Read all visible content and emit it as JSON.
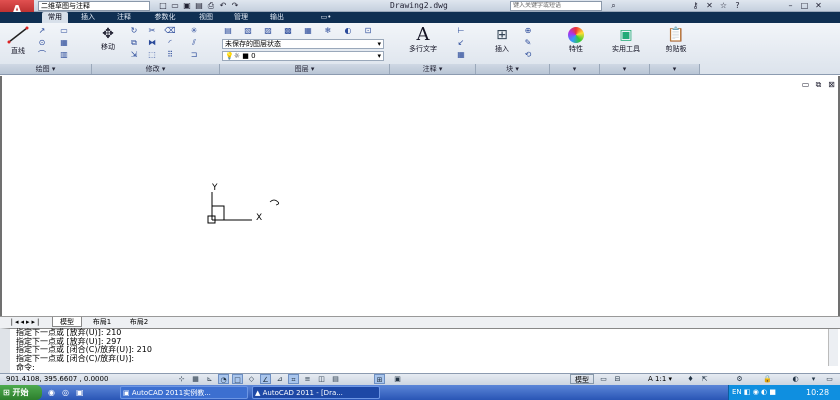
{
  "titlebar": {
    "app_button": "A",
    "workspace": "二维草图与注释",
    "document_title": "Drawing2.dwg",
    "search_placeholder": "键入关键字或短语"
  },
  "ribbon_tabs": [
    "常用",
    "插入",
    "注释",
    "参数化",
    "视图",
    "管理",
    "输出"
  ],
  "ribbon": {
    "draw": {
      "line": "直线",
      "label": "绘图"
    },
    "modify": {
      "move": "移动",
      "label": "修改"
    },
    "layers": {
      "state": "未保存的图层状态",
      "current_layer": "0",
      "label": "图层"
    },
    "annotation": {
      "mtext": "多行文字",
      "label": "注释"
    },
    "block": {
      "insert": "插入",
      "label": "块"
    },
    "properties": {
      "label": "特性"
    },
    "utilities": {
      "label": "实用工具"
    },
    "clipboard": {
      "label": "剪贴板"
    }
  },
  "ucs": {
    "y_label": "Y",
    "x_label": "X"
  },
  "layout_tabs": [
    "模型",
    "布局1",
    "布局2"
  ],
  "command_history": [
    "指定下一点或 [放弃(U)]: 210",
    "指定下一点或 [放弃(U)]: 297",
    "指定下一点或 [闭合(C)/放弃(U)]: 210",
    "指定下一点或 [闭合(C)/放弃(U)]:"
  ],
  "command_prompt": "命令:",
  "statusbar": {
    "coordinates": "901.4108, 395.6607 , 0.0000",
    "model": "模型",
    "annotation_scale": "1:1"
  },
  "taskbar": {
    "start": "开始",
    "tasks": [
      "AutoCAD 2011实例教...",
      "AutoCAD 2011 - [Dra..."
    ],
    "clock": "10:28"
  },
  "colors": {
    "accent": "#0f2f52",
    "taskbar": "#2955b5",
    "start": "#2d7f2d"
  }
}
